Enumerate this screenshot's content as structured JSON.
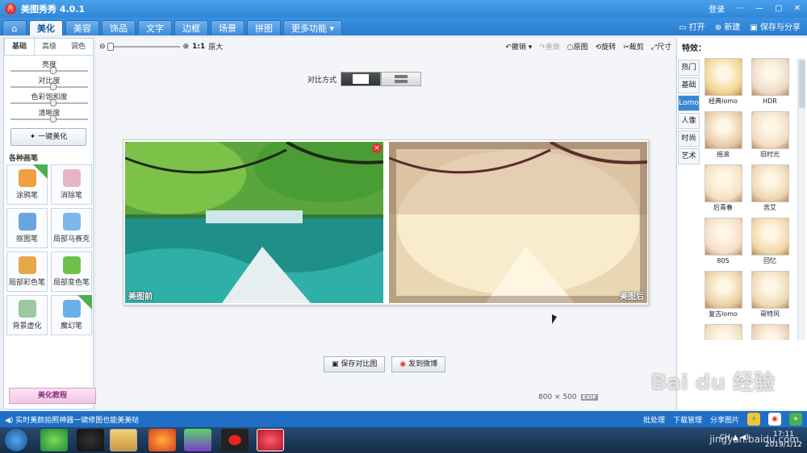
{
  "window": {
    "title": "美图秀秀 4.0.1",
    "logo_text": "秀",
    "login": "登录",
    "controls": [
      "—",
      "▢",
      "✕"
    ],
    "extra": "⋯"
  },
  "menu": {
    "tabs": [
      "美化",
      "美容",
      "饰品",
      "文字",
      "边框",
      "场景",
      "拼图",
      "更多功能 ▾"
    ],
    "right": {
      "open": "打开",
      "new": "新建",
      "save": "保存与分享"
    }
  },
  "left": {
    "subtabs": [
      "基础",
      "高级",
      "调色"
    ],
    "sliders": [
      {
        "label": "亮度",
        "value": 0.55
      },
      {
        "label": "对比度",
        "value": 0.55
      },
      {
        "label": "色彩饱和度",
        "value": 0.55
      },
      {
        "label": "清晰度",
        "value": 0.55
      }
    ],
    "one_key": "一键美化",
    "section": "各种画笔",
    "tools": [
      {
        "label": "涂鸦笔",
        "color": "#f0a040"
      },
      {
        "label": "消除笔",
        "color": "#e8b5c8"
      },
      {
        "label": "抠图笔",
        "color": "#6aa5e0"
      },
      {
        "label": "局部马赛克",
        "color": "#7bb8ea"
      },
      {
        "label": "局部彩色笔",
        "color": "#e7a64a"
      },
      {
        "label": "局部变色笔",
        "color": "#6cc24a"
      },
      {
        "label": "背景虚化",
        "color": "#9bc9a0"
      },
      {
        "label": "魔幻笔",
        "color": "#6ab0e8"
      }
    ],
    "tutorial": "美化教程"
  },
  "main": {
    "zoom_label": "1:1",
    "zoom_text": "原大",
    "actions": {
      "undo": "撤销 ▾",
      "redo": "重做",
      "original": "原图",
      "rotate": "旋转",
      "crop": "裁剪",
      "resize": "尺寸"
    },
    "compare_label": "对比方式",
    "before_tag": "美图前",
    "after_tag": "美图后",
    "save_compare": "保存对比图",
    "share": "发到微博",
    "dims": "800 × 500",
    "exif": "EXIF"
  },
  "right": {
    "title": "特效：",
    "categories": [
      "热门",
      "基础",
      "Lomo",
      "人像",
      "时尚",
      "艺术"
    ],
    "active_category": "Lomo",
    "effects": [
      "经典lomo",
      "HDR",
      "摇滚",
      "旧时光",
      "后青春",
      "苦艾",
      "80S",
      "回忆",
      "复古lomo",
      "哥特风",
      "",
      ""
    ]
  },
  "status": {
    "left": "实时美颜拍照神器一键修图也能美美哒",
    "right": [
      "批处理",
      "下载管理",
      "分享图片"
    ]
  },
  "taskbar": {
    "time": "17:11",
    "date": "2019/1/12",
    "tray": "CH ▲ ◀)"
  },
  "watermark": {
    "main": "Bai du 经验",
    "sub": "jingyan.baidu.com"
  }
}
